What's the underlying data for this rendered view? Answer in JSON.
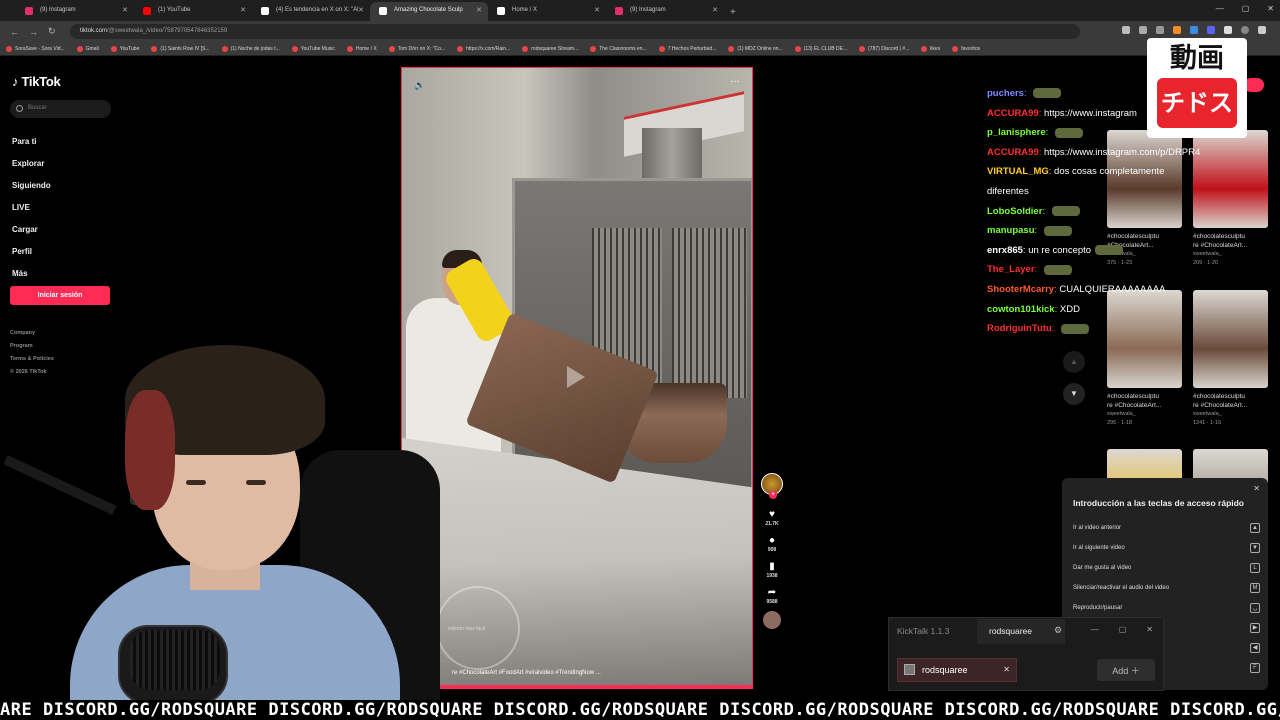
{
  "browser": {
    "tabs": [
      {
        "title": "(9) Instagram",
        "color": "#e1306c",
        "active": false
      },
      {
        "title": "(1) YouTube",
        "color": "#ff0000",
        "active": false
      },
      {
        "title": "(4) Es tendencia en X on X: \"Al",
        "color": "#ffffff",
        "active": false
      },
      {
        "title": "Amazing Chocolate Sculp",
        "color": "#ffffff",
        "active": true
      },
      {
        "title": "Home / X",
        "color": "#ffffff",
        "active": false
      },
      {
        "title": "(9) Instagram",
        "color": "#e1306c",
        "active": false
      }
    ],
    "url_host": "tiktok.com",
    "url_path": "/@sweetwala_/video/7587970547846352159",
    "bookmarks": [
      "SoraSave - Sora Vid...",
      "Gmail",
      "YouTube",
      "(1) Saints Row IV [S...",
      "(1) Noche de jodas t...",
      "YouTube Music",
      "Home / X",
      "Tom Dörr on X: \"Co...",
      "https://x.com/Rain...",
      "rodsquaree Stream...",
      "The Classrooms en...",
      "7 Hechos Perturbad...",
      "(1) MDZ Online on...",
      "(13) EL CLUB DE...",
      "(787) Discord | #...",
      "likes",
      "favoritos"
    ]
  },
  "tiktok": {
    "logo": "TikTok",
    "search_placeholder": "Buscar",
    "menu": [
      {
        "label": "Para ti",
        "icon": "home-icon"
      },
      {
        "label": "Explorar",
        "icon": "compass-icon"
      },
      {
        "label": "Siguiendo",
        "icon": "following-icon"
      },
      {
        "label": "LIVE",
        "icon": "live-icon"
      },
      {
        "label": "Cargar",
        "icon": "upload-icon"
      },
      {
        "label": "Perfil",
        "icon": "profile-icon"
      },
      {
        "label": "Más",
        "icon": "more-icon"
      }
    ],
    "login": "Iniciar sesión",
    "footer": [
      "Company",
      "Program",
      "Terms & Policies",
      "© 2026 TikTok"
    ],
    "video": {
      "caption": "re #ChocolateArt #FoodArt #viralvideo #TrendingNow ...",
      "stamp_text": "edición más fácil"
    },
    "actions": {
      "likes": "21.7K",
      "comments": "908",
      "saves": "1938",
      "shares": "9588"
    }
  },
  "chat": [
    {
      "user": "puchers",
      "color": "#7b8cff",
      "msg": ""
    },
    {
      "user": "ACCURA99",
      "color": "#ff3030",
      "msg": "https://www.instagram"
    },
    {
      "user": "p_lanisphere",
      "color": "#7dff3a",
      "msg": ""
    },
    {
      "user": "ACCURA99",
      "color": "#ff3030",
      "msg": "https://www.instagram.com/p/DRPR4"
    },
    {
      "user": "VIRTUAL_MG",
      "color": "#ffd02a",
      "msg": "dos cosas completamente"
    },
    {
      "user": "",
      "color": "#ffffff",
      "msg": "diferentes"
    },
    {
      "user": "LoboSoldier",
      "color": "#7dff3a",
      "msg": ""
    },
    {
      "user": "manupasu",
      "color": "#7dff3a",
      "msg": ""
    },
    {
      "user": "enrx865",
      "color": "#ffffff",
      "msg": "un re concepto"
    },
    {
      "user": "The_Layer",
      "color": "#ff3030",
      "msg": ""
    },
    {
      "user": "ShooterMcarry",
      "color": "#ff5a2a",
      "msg": "CUALQUIERAAAAAAAA"
    },
    {
      "user": "cowton101kick",
      "color": "#7dff3a",
      "msg": "XDD"
    },
    {
      "user": "RodriguinTutu",
      "color": "#ff3030",
      "msg": ""
    }
  ],
  "grid": [
    {
      "tag": "#chocolatesculptu",
      "tag2": "#ChocolateArt...",
      "user": "sweetwala_",
      "stats": "375 · 1-23",
      "bg": "#5a3a2a"
    },
    {
      "tag": "#chocolatesculptu",
      "tag2": "re #ChocolateArt...",
      "user": "sweetwala_",
      "stats": "209 · 1-20",
      "bg": "#c0101a"
    },
    {
      "tag": "#chocolatesculptu",
      "tag2": "re #ChocolateArt...",
      "user": "sweetwala_",
      "stats": "295 · 1-18",
      "bg": "#8a6a55"
    },
    {
      "tag": "#chocolatesculptu",
      "tag2": "re #ChocolateArt...",
      "user": "sweetwala_",
      "stats": "1241 · 1-16",
      "bg": "#6a4a3a"
    },
    {
      "tag": "",
      "tag2": "",
      "user": "",
      "stats": "",
      "bg": "#e8b820"
    },
    {
      "tag": "",
      "tag2": "",
      "user": "",
      "stats": "",
      "bg": "#9a8f85"
    }
  ],
  "logo_overlay": {
    "top": "動画",
    "bottom": "チドス"
  },
  "shortcuts": {
    "title": "Introducción a las teclas de acceso rápido",
    "items": [
      {
        "label": "Ir al video anterior",
        "key": "▲"
      },
      {
        "label": "Ir al siguiente video",
        "key": "▼"
      },
      {
        "label": "Dar me gusta al video",
        "key": "L"
      },
      {
        "label": "Silenciar/reactivar el audio del video",
        "key": "M"
      },
      {
        "label": "Reproducir/pausar",
        "key": "␣"
      },
      {
        "label": "",
        "key": "▶"
      },
      {
        "label": "",
        "key": "◀"
      },
      {
        "label": "",
        "key": "F"
      }
    ]
  },
  "kicktalk": {
    "title": "KickTalk 1.1.3",
    "tab": "rodsquaree",
    "channel": "rodsquaree",
    "add": "Add ＋"
  },
  "ticker": "ARE DISCORD.GG/RODSQUARE DISCORD.GG/RODSQUARE DISCORD.GG/RODSQUARE DISCORD.GG/RODSQUARE DISCORD.GG/RODSQUARE DISCORD.GG/RODSQUARE"
}
